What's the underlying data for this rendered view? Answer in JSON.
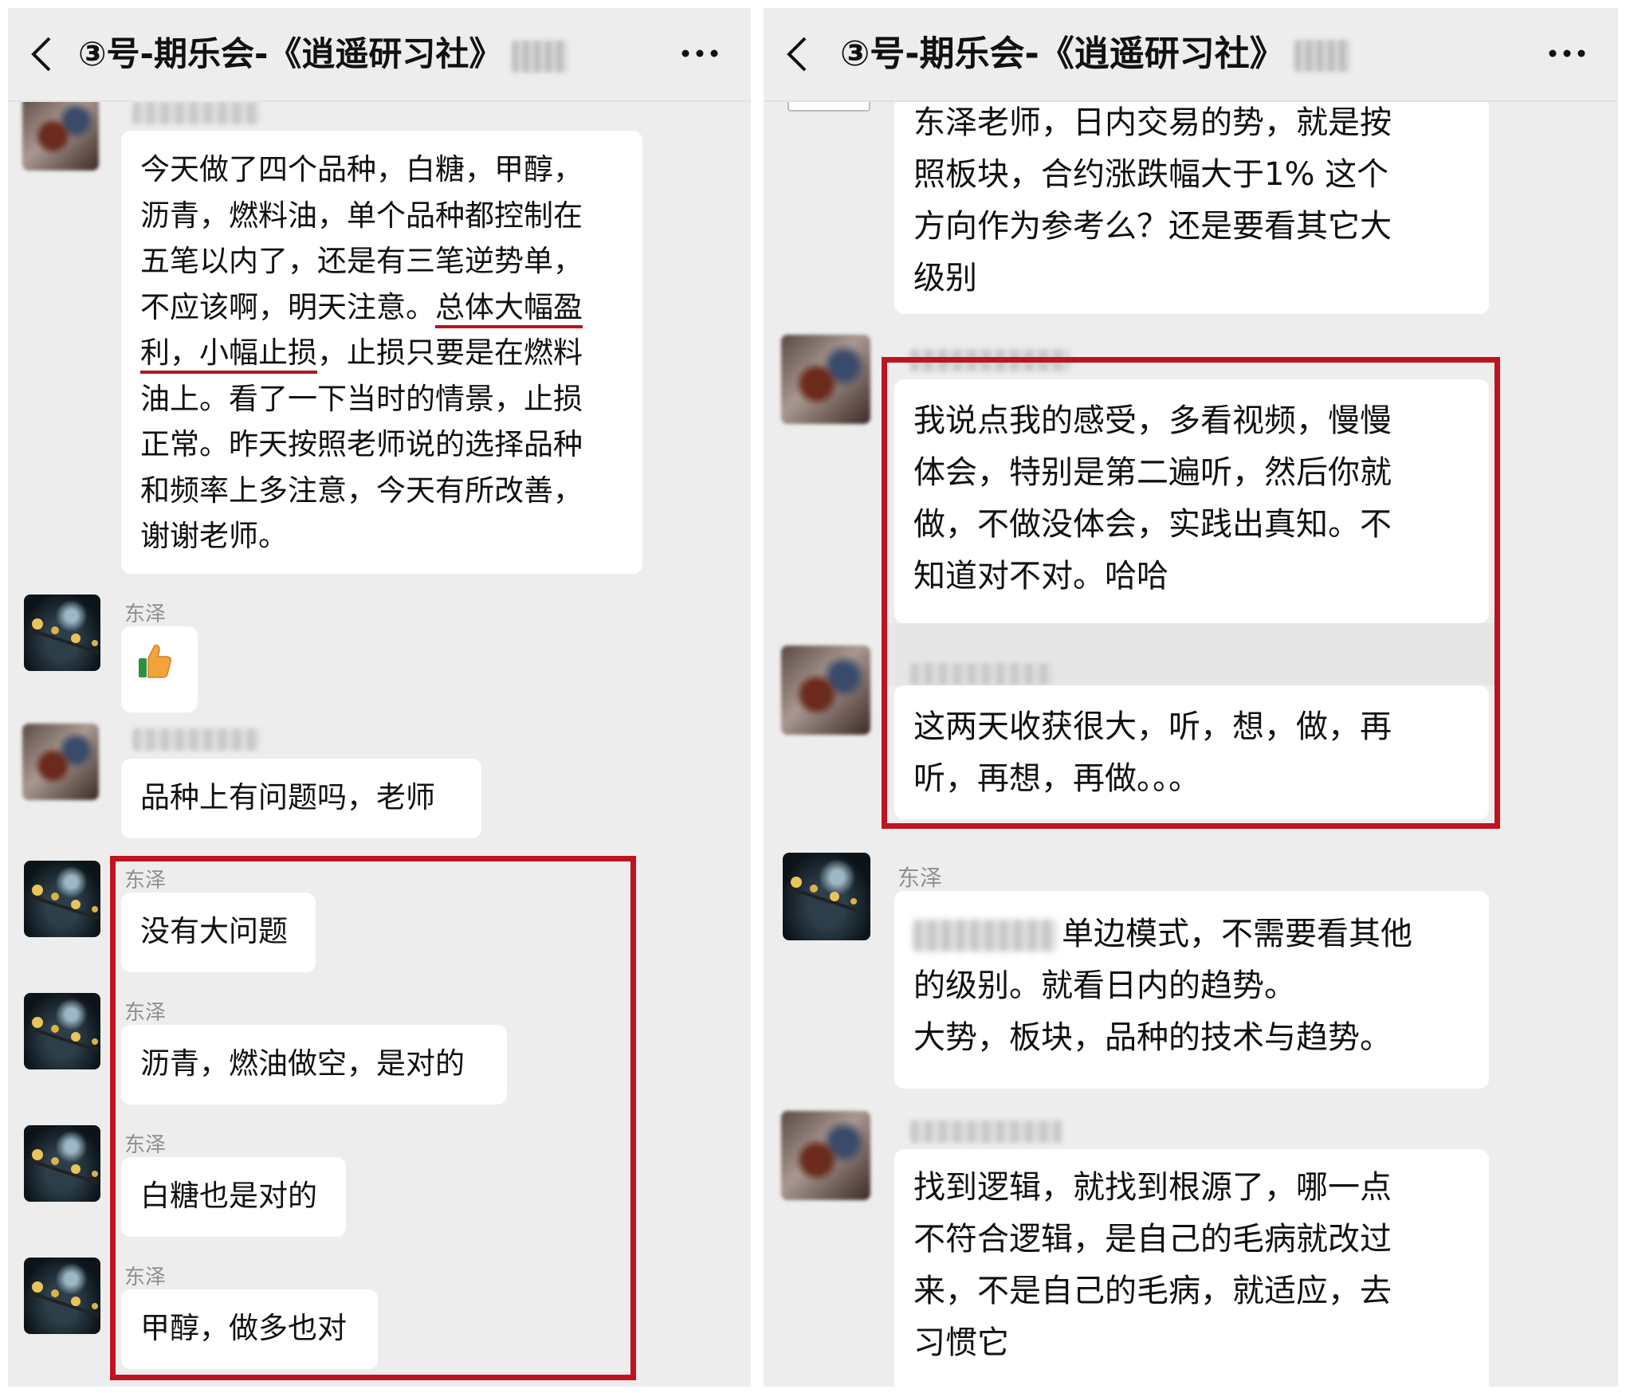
{
  "left": {
    "header": {
      "title": "③号-期乐会-《逍遥研习社》"
    },
    "messages": [
      {
        "sender": "",
        "lines": [
          "今天做了四个品种，白糖，甲醇，",
          "沥青，燃料油，单个品种都控制在",
          "五笔以内了，还是有三笔逆势单，",
          "不应该啊，明天注意。",
          "总体大幅盈",
          "利，小幅止损",
          "，止损只要是在燃料",
          "油上。看了一下当时的情景，止损",
          "正常。昨天按照老师说的选择品种",
          "和频率上多注意，今天有所改善，",
          "谢谢老师。"
        ]
      },
      {
        "sender": "东泽",
        "emoji": "thumbs-up"
      },
      {
        "sender": "",
        "text": "品种上有问题吗，老师"
      },
      {
        "sender": "东泽",
        "text": "没有大问题"
      },
      {
        "sender": "东泽",
        "text": "沥青，燃油做空，是对的"
      },
      {
        "sender": "东泽",
        "text": "白糖也是对的"
      },
      {
        "sender": "东泽",
        "text": "甲醇，做多也对"
      }
    ]
  },
  "right": {
    "header": {
      "title": "③号-期乐会-《逍遥研习社》"
    },
    "messages": [
      {
        "sender": "",
        "lines": [
          "东泽老师，日内交易的势，就是按",
          "照板块，合约涨跌幅大于1% 这个",
          "方向作为参考么？还是要看其它大",
          "级别"
        ]
      },
      {
        "sender": "",
        "lines": [
          "我说点我的感受，多看视频，慢慢",
          "体会，特别是第二遍听，然后你就",
          "做，不做没体会，实践出真知。不",
          "知道对不对。哈哈"
        ]
      },
      {
        "sender": "",
        "lines": [
          "这两天收获很大，听，想，做，再",
          "听，再想，再做。。。"
        ]
      },
      {
        "sender": "东泽",
        "lines": [
          "单边模式，不需要看其他",
          "的级别。就看日内的趋势。",
          "大势，板块，品种的技术与趋势。"
        ]
      },
      {
        "sender": "",
        "lines": [
          "找到逻辑，就找到根源了，哪一点",
          "不符合逻辑，是自己的毛病就改过",
          "来，不是自己的毛病，就适应，去",
          "习惯它"
        ]
      }
    ]
  },
  "colors": {
    "background": "#ededed",
    "bubble": "#ffffff",
    "highlight": "#c1121f",
    "sender": "#8f8f8f"
  }
}
